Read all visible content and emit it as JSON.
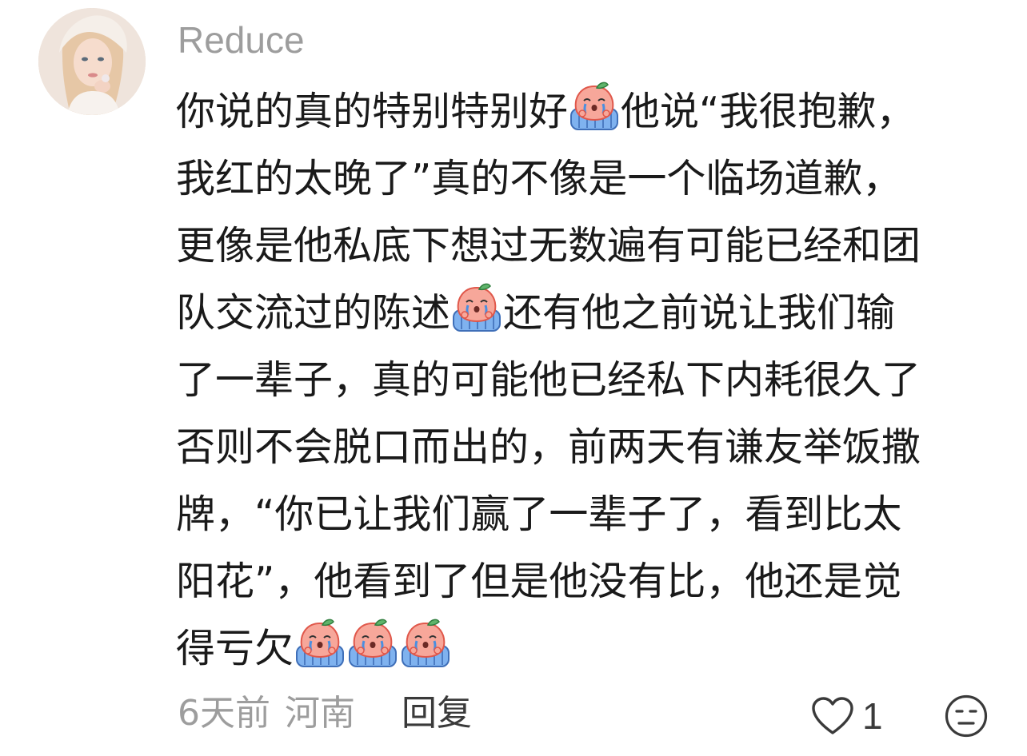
{
  "comment": {
    "username": "Reduce",
    "avatar_icon": "user-avatar",
    "emoji_icon": "crying-peach-emoji",
    "lines": [
      [
        "你说的真的特别特别好",
        "[emoji]",
        "他说“我很抱歉，"
      ],
      [
        "我红的太晚了”真的不像是一个临场道歉，"
      ],
      [
        "更像是他私底下想过无数遍有可能已经和团"
      ],
      [
        "队交流过的陈述",
        "[emoji]",
        "还有他之前说让我们输"
      ],
      [
        "了一辈子，真的可能他已经私下内耗很久了"
      ],
      [
        "否则不会脱口而出的，前两天有谦友举饭撒"
      ],
      [
        "牌，“你已让我们赢了一辈子了，看到比太"
      ],
      [
        "阳花”，他看到了但是他没有比，他还是觉"
      ],
      [
        "得亏欠",
        "[emoji]",
        "[emoji]",
        "[emoji]"
      ]
    ],
    "line_text": {
      "l1a": "你说的真的特别特别好",
      "l1b": "他说“我很抱歉，",
      "l2": "我红的太晚了”真的不像是一个临场道歉，",
      "l3": "更像是他私底下想过无数遍有可能已经和团",
      "l4a": "队交流过的陈述",
      "l4b": "还有他之前说让我们输",
      "l5": "了一辈子，真的可能他已经私下内耗很久了",
      "l6": "否则不会脱口而出的，前两天有谦友举饭撒",
      "l7": "牌，“你已让我们赢了一辈子了，看到比太",
      "l8": "阳花”，他看到了但是他没有比，他还是觉",
      "l9": "得亏欠"
    },
    "time_ago": "6天前",
    "location": "河南",
    "reply_label": "回复",
    "like_count": "1",
    "like_icon": "heart-icon",
    "dislike_icon": "frown-face-icon",
    "colors": {
      "meta_gray": "#9d9d9d",
      "text": "#1a1a1a",
      "action": "#3a3a3a"
    }
  }
}
